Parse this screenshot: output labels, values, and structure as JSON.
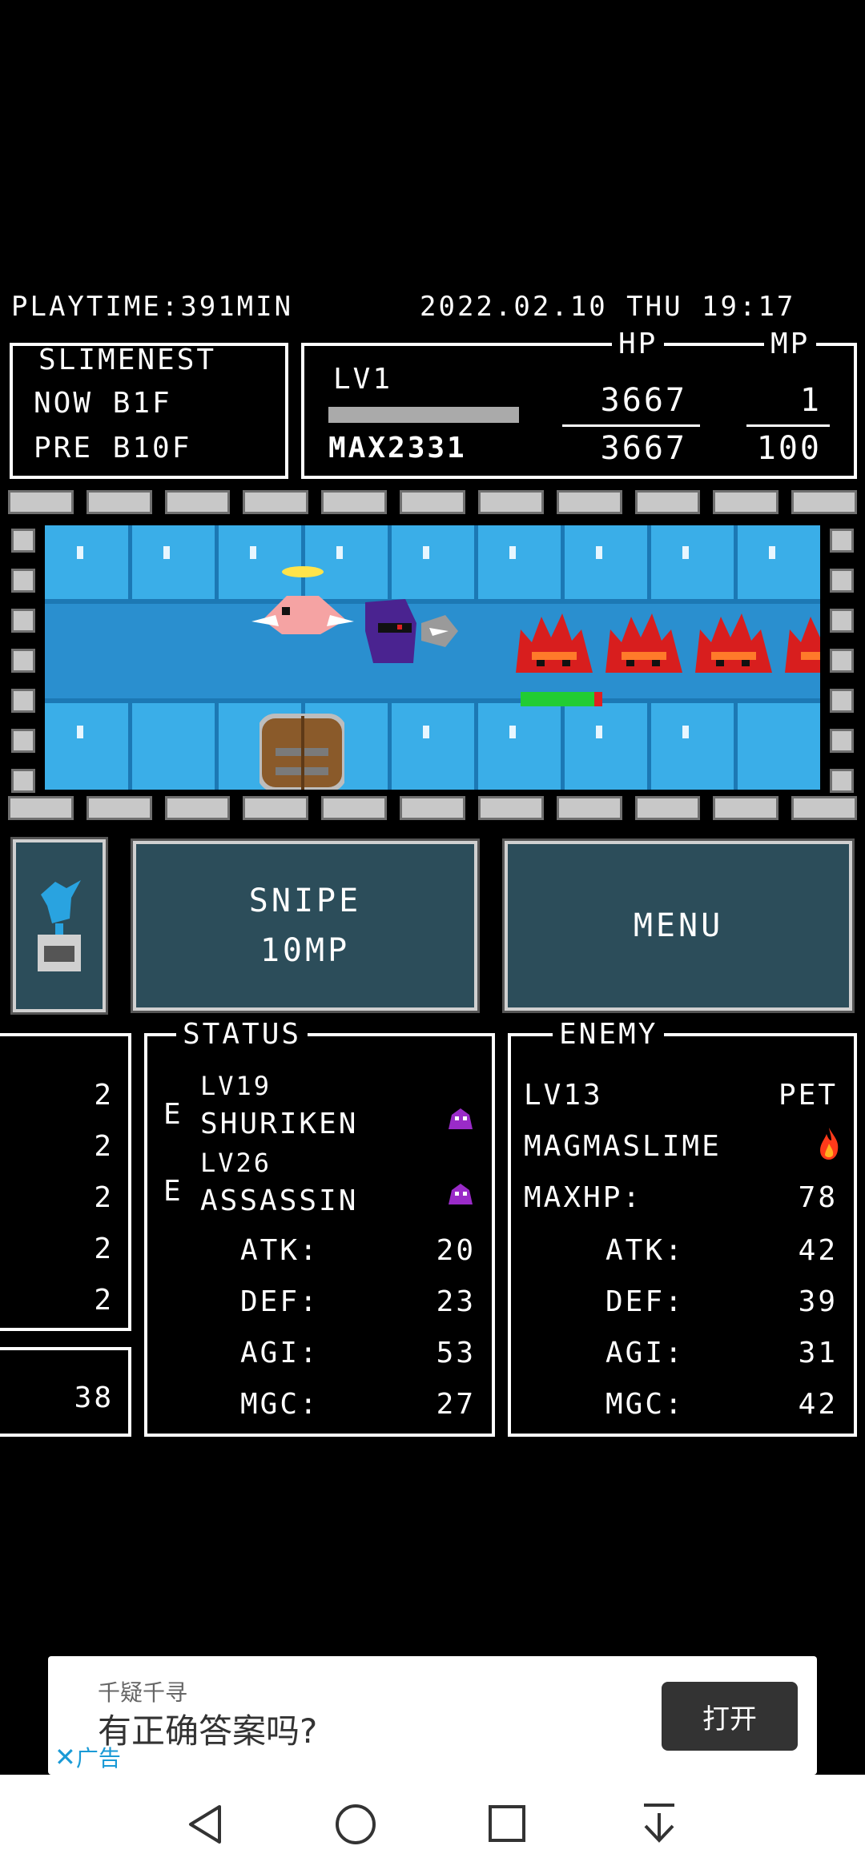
{
  "header": {
    "playtime": "PLAYTIME:391MIN",
    "datetime": "2022.02.10 THU 19:17"
  },
  "location": {
    "title": "SLIMENEST",
    "now": "NOW B1F",
    "pre": "PRE B10F"
  },
  "player": {
    "level": "LV1",
    "exp_max": "MAX2331",
    "hp_label": "HP",
    "mp_label": "MP",
    "hp_current": "3667",
    "hp_max": "3667",
    "mp_current": "1",
    "mp_max": "100"
  },
  "enemy_hp_fraction": 0.9,
  "buttons": {
    "snipe_line1": "SNIPE",
    "snipe_line2": "10MP",
    "menu": "MENU"
  },
  "left_panel": {
    "values": [
      "2",
      "2",
      "2",
      "2",
      "2"
    ],
    "extra": "38"
  },
  "status": {
    "title": "STATUS",
    "equips": [
      {
        "marker": "E",
        "level": "LV19",
        "name": "SHURIKEN"
      },
      {
        "marker": "E",
        "level": "LV26",
        "name": "ASSASSIN"
      }
    ],
    "stats": [
      {
        "label": "ATK:",
        "value": "20"
      },
      {
        "label": "DEF:",
        "value": "23"
      },
      {
        "label": "AGI:",
        "value": "53"
      },
      {
        "label": "MGC:",
        "value": "27"
      }
    ]
  },
  "enemy": {
    "title": "ENEMY",
    "level": "LV13",
    "tag": "PET",
    "name": "MAGMASLIME",
    "maxhp_label": "MAXHP:",
    "maxhp": "78",
    "stats": [
      {
        "label": "ATK:",
        "value": "42"
      },
      {
        "label": "DEF:",
        "value": "39"
      },
      {
        "label": "AGI:",
        "value": "31"
      },
      {
        "label": "MGC:",
        "value": "42"
      }
    ]
  },
  "ad": {
    "source": "千疑千寻",
    "title": "有正确答案吗?",
    "tag": "广告",
    "open_button": "打开"
  },
  "colors": {
    "button_bg": "#2c4d5a",
    "water": "#29a3e0",
    "hp_green": "#22cc33",
    "hp_red": "#e02020"
  },
  "icons": [
    "bird-statue-icon",
    "purple-slime-icon",
    "fire-icon",
    "close-icon",
    "back-icon",
    "home-icon",
    "recents-icon",
    "download-icon"
  ]
}
